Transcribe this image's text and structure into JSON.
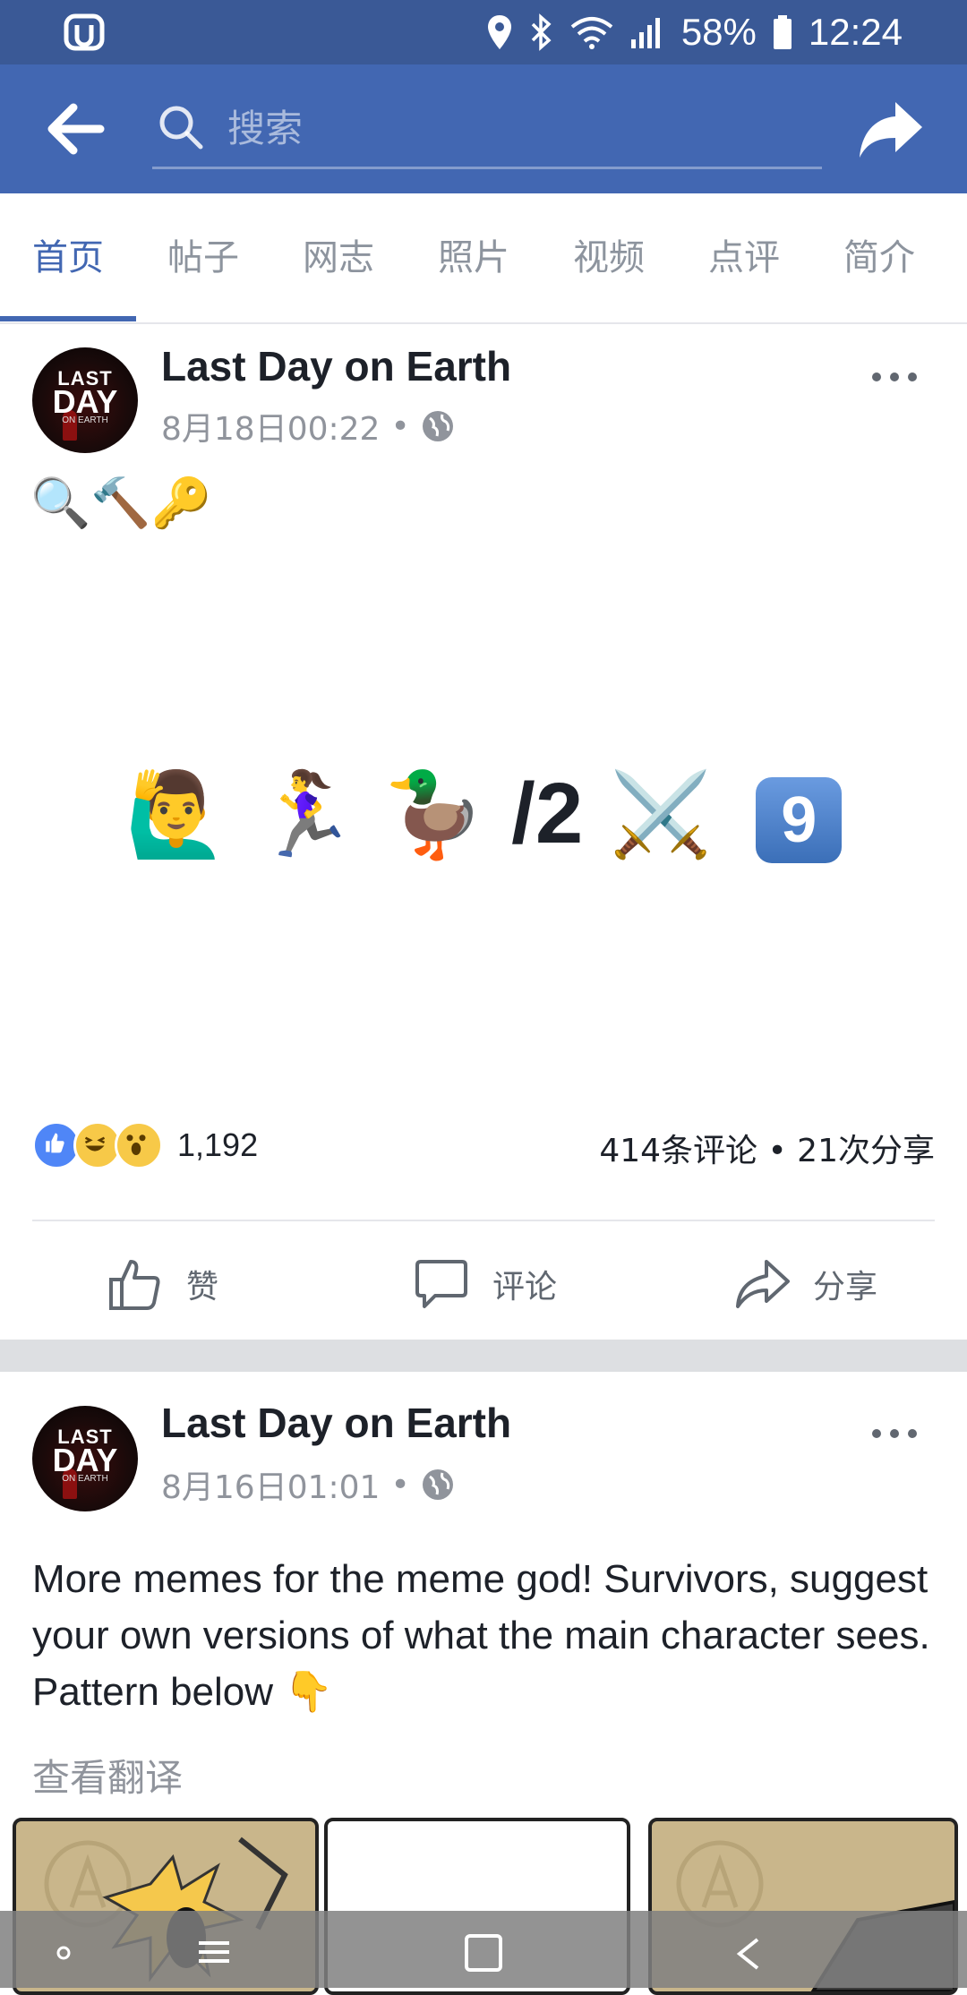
{
  "status_bar": {
    "battery": "58%",
    "time": "12:24"
  },
  "search": {
    "placeholder": "搜索"
  },
  "tabs": [
    "首页",
    "帖子",
    "网志",
    "照片",
    "视频",
    "点评",
    "简介"
  ],
  "posts": [
    {
      "author": "Last Day on Earth",
      "timestamp": "8月18日00:22",
      "avatar_text": [
        "LAST",
        "DAY",
        "ON EARTH"
      ],
      "body_emoji_line": "🔍🔨🔑",
      "body_big": [
        "🙋‍♂️",
        "🏃‍♀️",
        "🦆",
        "/2",
        "⚔️",
        "9"
      ],
      "reaction_count": "1,192",
      "comments_shares": "414条评论 • 21次分享",
      "actions": {
        "like": "赞",
        "comment": "评论",
        "share": "分享"
      }
    },
    {
      "author": "Last Day on Earth",
      "timestamp": "8月16日01:01",
      "avatar_text": [
        "LAST",
        "DAY",
        "ON EARTH"
      ],
      "text": "More memes for the meme god! Survivors, suggest your own versions of what the main character sees. Pattern below 👇",
      "translate_link": "查看翻译"
    }
  ],
  "colors": {
    "status_bar": "#3a5996",
    "header": "#4267b2",
    "accent": "#4267b2",
    "separator": "#dddfe2"
  },
  "icons": [
    "location-icon",
    "bluetooth-icon",
    "wifi-icon",
    "signal-icon",
    "battery-icon",
    "back-arrow-icon",
    "search-icon",
    "share-forward-icon",
    "globe-icon",
    "more-icon",
    "like-icon",
    "comment-icon",
    "share-icon"
  ]
}
